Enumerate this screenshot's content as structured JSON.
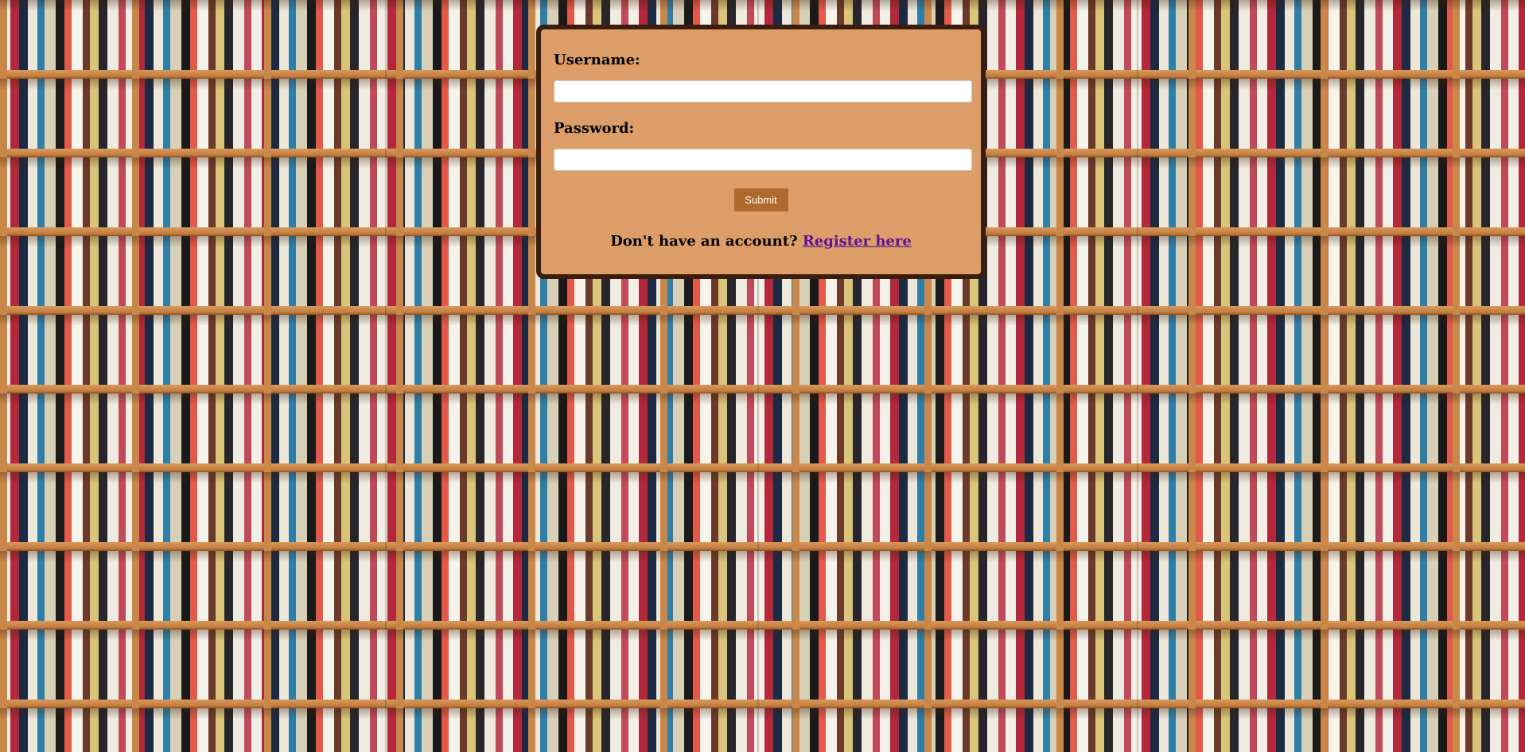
{
  "background": {
    "description_icon": "bookshelf-background-image"
  },
  "login": {
    "username_label": "Username:",
    "username_value": "",
    "password_label": "Password:",
    "password_value": "",
    "submit_label": "Submit",
    "register_prompt": "Don't have an account?",
    "register_link": "Register here"
  },
  "colors": {
    "card_background": "#dc9d68",
    "card_border": "#3a1d0c",
    "submit_background": "#b0692d",
    "link": "#5b1596"
  }
}
